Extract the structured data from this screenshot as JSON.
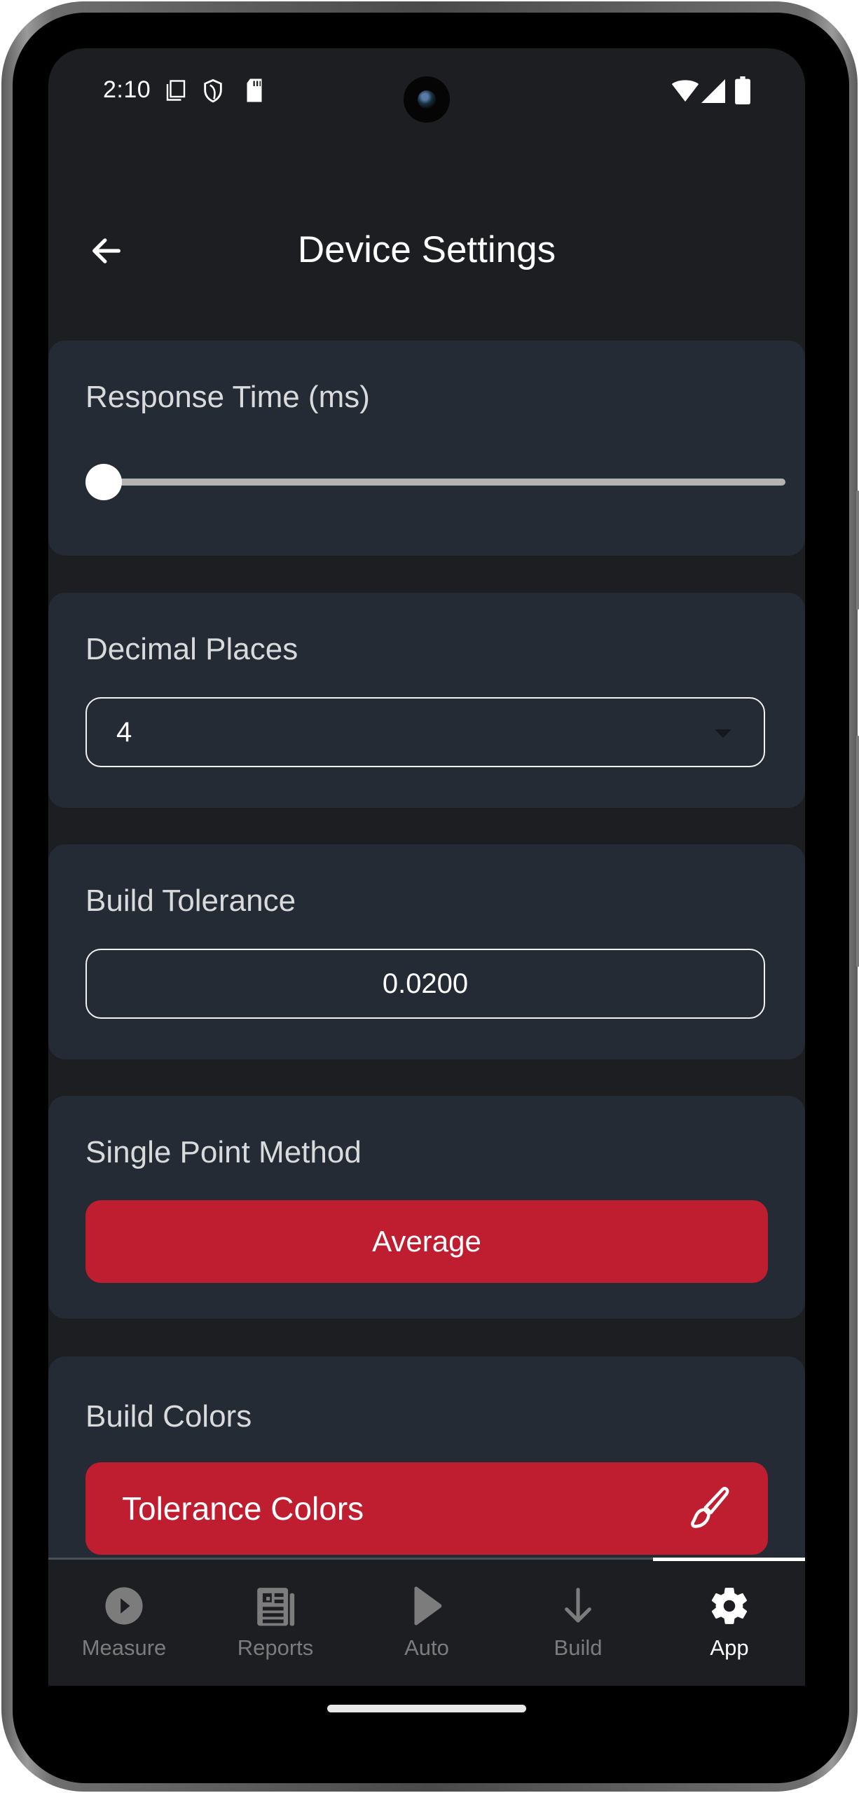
{
  "status_bar": {
    "time": "2:10",
    "left_icons": [
      "screenshot-icon",
      "shield-icon",
      "sd-card-icon"
    ],
    "right_icons": [
      "wifi-icon",
      "cellular-signal-icon",
      "battery-icon"
    ]
  },
  "app_bar": {
    "back_icon": "arrow-left-icon",
    "title": "Device Settings"
  },
  "settings": {
    "response_time": {
      "label": "Response Time (ms)",
      "slider_fraction": 0.0
    },
    "decimal_places": {
      "label": "Decimal Places",
      "selected": "4",
      "dropdown_icon": "caret-down-icon"
    },
    "build_tolerance": {
      "label": "Build Tolerance",
      "value": "0.0200"
    },
    "single_point_method": {
      "label": "Single Point Method",
      "button_label": "Average"
    },
    "build_colors": {
      "label": "Build Colors",
      "button_label": "Tolerance Colors",
      "button_icon": "paintbrush-icon"
    }
  },
  "bottom_nav": {
    "items": [
      {
        "label": "Measure",
        "icon": "play-circle-icon",
        "active": false
      },
      {
        "label": "Reports",
        "icon": "newspaper-icon",
        "active": false
      },
      {
        "label": "Auto",
        "icon": "play-icon",
        "active": false
      },
      {
        "label": "Build",
        "icon": "arrow-down-icon",
        "active": false
      },
      {
        "label": "App",
        "icon": "gear-icon",
        "active": true
      }
    ]
  },
  "colors": {
    "background": "#1c1e22",
    "card": "#252b35",
    "accent_red": "#be1e2f",
    "inactive_nav": "#7c7c7c",
    "active_nav": "#ffffff"
  }
}
